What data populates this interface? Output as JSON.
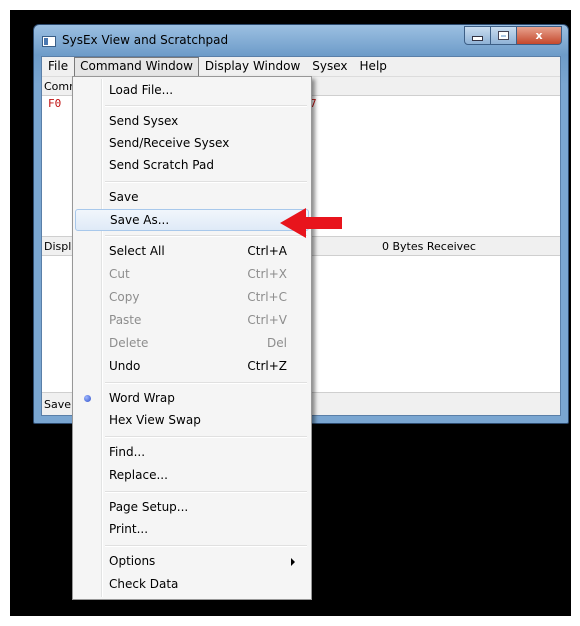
{
  "window": {
    "title": "SysEx View and Scratchpad",
    "controls": {
      "minimize": "minimize-button",
      "maximize": "maximize-button",
      "close": "x"
    }
  },
  "menubar": [
    "File",
    "Command Window",
    "Display Window",
    "Sysex",
    "Help"
  ],
  "panes": {
    "command_header": "Comm",
    "command_hex_left": "F0",
    "command_hex_right": "7",
    "display_header": "Displ",
    "bytes_received": "0  Bytes Receivec",
    "status": "Save"
  },
  "dropdown": {
    "items": [
      {
        "label": "Load File...",
        "shortcut": "",
        "enabled": true
      },
      {
        "label": "Send Sysex",
        "shortcut": "",
        "enabled": true
      },
      {
        "label": "Send/Receive Sysex",
        "shortcut": "",
        "enabled": true
      },
      {
        "label": "Send Scratch Pad",
        "shortcut": "",
        "enabled": true
      },
      {
        "label": "Save",
        "shortcut": "",
        "enabled": true
      },
      {
        "label": "Save As...",
        "shortcut": "",
        "enabled": true,
        "highlighted": true
      },
      {
        "label": "Select All",
        "shortcut": "Ctrl+A",
        "enabled": true
      },
      {
        "label": "Cut",
        "shortcut": "Ctrl+X",
        "enabled": false
      },
      {
        "label": "Copy",
        "shortcut": "Ctrl+C",
        "enabled": false
      },
      {
        "label": "Paste",
        "shortcut": "Ctrl+V",
        "enabled": false
      },
      {
        "label": "Delete",
        "shortcut": "Del",
        "enabled": false
      },
      {
        "label": "Undo",
        "shortcut": "Ctrl+Z",
        "enabled": true
      },
      {
        "label": "Word Wrap",
        "shortcut": "",
        "enabled": true,
        "checked": true
      },
      {
        "label": "Hex View Swap",
        "shortcut": "",
        "enabled": true
      },
      {
        "label": "Find...",
        "shortcut": "",
        "enabled": true
      },
      {
        "label": "Replace...",
        "shortcut": "",
        "enabled": true
      },
      {
        "label": "Page Setup...",
        "shortcut": "",
        "enabled": true
      },
      {
        "label": "Print...",
        "shortcut": "",
        "enabled": true
      },
      {
        "label": "Options",
        "shortcut": "",
        "enabled": true,
        "submenu": true
      },
      {
        "label": "Check Data",
        "shortcut": "",
        "enabled": true
      }
    ]
  },
  "colors": {
    "annotation_arrow": "#e8141c",
    "hex_text": "#c01010",
    "menu_highlight": "#dfeaf7"
  },
  "icons": {
    "app": "window-app-icon",
    "checked": "radio-dot-icon",
    "submenu": "chevron-right-icon",
    "annotation": "red-arrow-icon"
  }
}
